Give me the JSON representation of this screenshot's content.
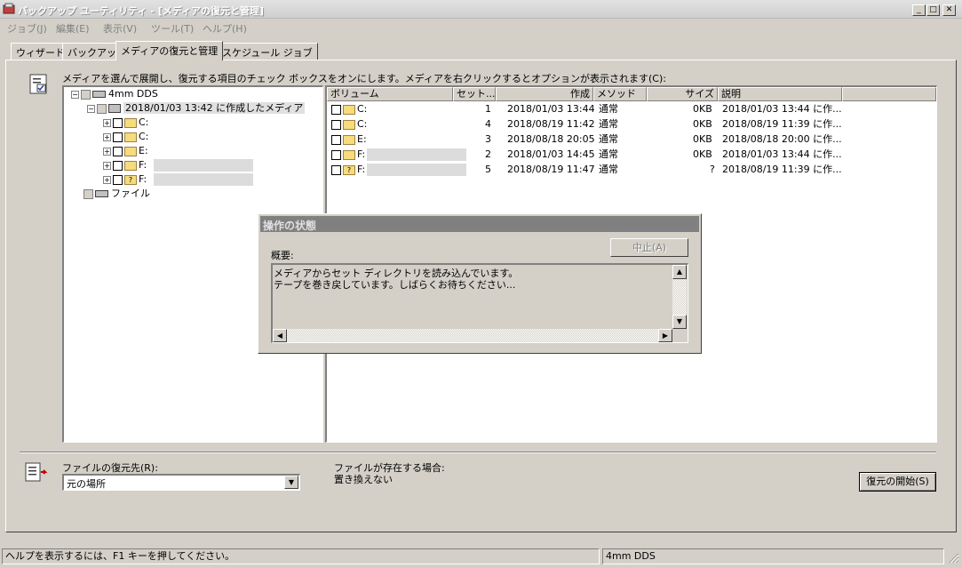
{
  "window": {
    "title": "バックアップ ユーティリティ - [メディアの復元と管理]"
  },
  "menu": [
    "ジョブ(J)",
    "編集(E)",
    "表示(V)",
    "ツール(T)",
    "ヘルプ(H)"
  ],
  "tabs": [
    "ウィザード",
    "バックアップ",
    "メディアの復元と管理",
    "スケジュール ジョブ"
  ],
  "instruction": "メディアを選んで展開し、復元する項目のチェック ボックスをオンにします。メディアを右クリックするとオプションが表示されます(C):",
  "tree": {
    "root": "4mm DDS",
    "media": "2018/01/03 13:42 に作成したメディア",
    "items": [
      "C:",
      "C:",
      "E:",
      "F:",
      "F:"
    ],
    "file_node": "ファイル"
  },
  "list": {
    "columns": [
      "ボリューム",
      "セット...",
      "作成",
      "メソッド",
      "サイズ",
      "説明"
    ],
    "rows": [
      {
        "volume": "C:",
        "set": "1",
        "created": "2018/01/03 13:44",
        "method": "通常",
        "size": "0KB",
        "desc": "2018/01/03 13:44 に作..."
      },
      {
        "volume": "C:",
        "set": "4",
        "created": "2018/08/19 11:42",
        "method": "通常",
        "size": "0KB",
        "desc": "2018/08/19 11:39 に作..."
      },
      {
        "volume": "E:",
        "set": "3",
        "created": "2018/08/18 20:05",
        "method": "通常",
        "size": "0KB",
        "desc": "2018/08/18 20:00 に作..."
      },
      {
        "volume": "F:",
        "set": "2",
        "created": "2018/01/03 14:45",
        "method": "通常",
        "size": "0KB",
        "desc": "2018/01/03 13:44 に作..."
      },
      {
        "volume": "F:",
        "set": "5",
        "created": "2018/08/19 11:47",
        "method": "通常",
        "size": "?",
        "desc": "2018/08/19 11:39 に作..."
      }
    ]
  },
  "dialog": {
    "title": "操作の状態",
    "stop_label": "中止(A)",
    "summary_label": "概要:",
    "line1": "メディアからセット ディレクトリを読み込んでいます。",
    "line2": "テープを巻き戻しています。しばらくお待ちください..."
  },
  "bottom": {
    "restore_to_label": "ファイルの復元先(R):",
    "restore_to_value": "元の場所",
    "exists_label": "ファイルが存在する場合:",
    "exists_value": "置き換えない",
    "start_label": "復元の開始(S)"
  },
  "status": {
    "help": "ヘルプを表示するには、F1 キーを押してください。",
    "media": "4mm DDS"
  }
}
